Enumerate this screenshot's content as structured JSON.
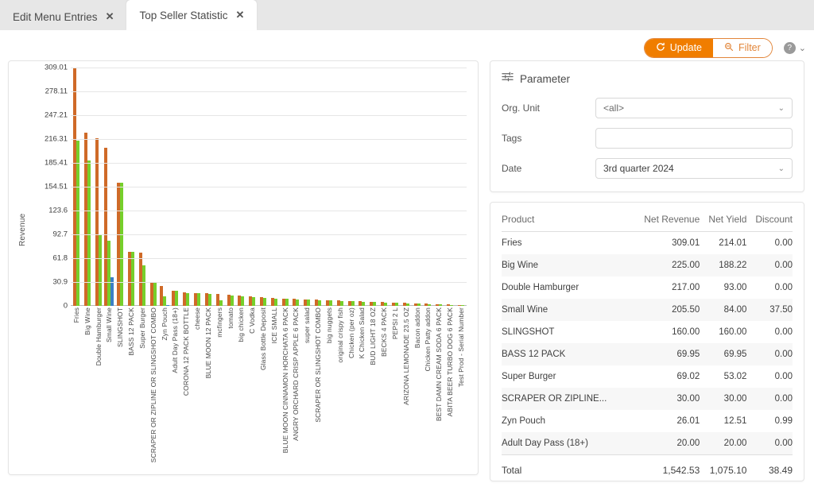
{
  "tabs": [
    {
      "label": "Edit Menu Entries",
      "close": "✕",
      "active": false
    },
    {
      "label": "Top Seller Statistic",
      "close": "✕",
      "active": true
    }
  ],
  "toolbar": {
    "update_label": "Update",
    "filter_label": "Filter",
    "help_label": "?",
    "chevron": "⌄",
    "update_color": "#f07d00",
    "filter_color": "#e2863a"
  },
  "parameter": {
    "title": "Parameter",
    "org_unit_label": "Org. Unit",
    "org_unit_value": "<all>",
    "tags_label": "Tags",
    "tags_value": "",
    "date_label": "Date",
    "date_value": "3rd quarter 2024",
    "caret": "⌄"
  },
  "table": {
    "columns": [
      "Product",
      "Net Revenue",
      "Net Yield",
      "Discount"
    ],
    "rows": [
      {
        "product": "Fries",
        "net_revenue": "309.01",
        "net_yield": "214.01",
        "discount": "0.00"
      },
      {
        "product": "Big Wine",
        "net_revenue": "225.00",
        "net_yield": "188.22",
        "discount": "0.00"
      },
      {
        "product": "Double Hamburger",
        "net_revenue": "217.00",
        "net_yield": "93.00",
        "discount": "0.00"
      },
      {
        "product": "Small Wine",
        "net_revenue": "205.50",
        "net_yield": "84.00",
        "discount": "37.50"
      },
      {
        "product": "SLINGSHOT",
        "net_revenue": "160.00",
        "net_yield": "160.00",
        "discount": "0.00"
      },
      {
        "product": "BASS 12 PACK",
        "net_revenue": "69.95",
        "net_yield": "69.95",
        "discount": "0.00"
      },
      {
        "product": "Super Burger",
        "net_revenue": "69.02",
        "net_yield": "53.02",
        "discount": "0.00"
      },
      {
        "product": "SCRAPER OR ZIPLINE...",
        "net_revenue": "30.00",
        "net_yield": "30.00",
        "discount": "0.00"
      },
      {
        "product": "Zyn Pouch",
        "net_revenue": "26.01",
        "net_yield": "12.51",
        "discount": "0.99"
      },
      {
        "product": "Adult Day Pass (18+)",
        "net_revenue": "20.00",
        "net_yield": "20.00",
        "discount": "0.00"
      }
    ],
    "total": {
      "product": "Total",
      "net_revenue": "1,542.53",
      "net_yield": "1,075.10",
      "discount": "38.49"
    }
  },
  "chart_data": {
    "type": "bar",
    "title": "",
    "xlabel": "",
    "ylabel": "Revenue",
    "ylim": [
      0,
      309.01
    ],
    "grid": true,
    "legend": "none",
    "yticks": [
      "0",
      "30.9",
      "61.8",
      "92.7",
      "123.6",
      "154.51",
      "185.41",
      "216.31",
      "247.21",
      "278.11",
      "309.01"
    ],
    "ytick_values": [
      0,
      30.9,
      61.8,
      92.7,
      123.6,
      154.51,
      185.41,
      216.31,
      247.21,
      278.11,
      309.01
    ],
    "colors": {
      "net_revenue": "#cf6a28",
      "net_yield": "#76cf2b",
      "discount": "#3a7fc4"
    },
    "categories": [
      "Fries",
      "Big Wine",
      "Double Hamburger",
      "Small Wine",
      "SLINGSHOT",
      "BASS 12 PACK",
      "Super Burger",
      "SCRAPER OR ZIPLINE OR SLINGSHOT COMBO",
      "Zyn Pouch",
      "Adult Day Pass (18+)",
      "CORONA 12 PACK BOTTLE",
      "cheese",
      "BLUE MOON 12 PACK",
      "mcfingers",
      "tomato",
      "big chicken",
      "C Vodka",
      "Glass Bottle Deposit",
      "ICE SMALL",
      "BLUE MOON CINNAMON HORCHATA 6 PACK",
      "ANGRY ORCHARD CRISP APPLE 6 PACK",
      "super salad",
      "SCRAPER OR SLINGSHOT COMBO",
      "big nuggets",
      "original crispy fish",
      "Chicken (per oz)",
      "K Chicken Salad",
      "BUD LIGHT 18 OZ",
      "BECKS 4 PACK",
      "PEPSI 2 L",
      "ARIZONA LEMONADE 23.5 OZ",
      "Bacon addon",
      "Chicken Patty addon",
      "BEST DAMN CREAM SODA 6 PACK",
      "ABITA BEER TURBO DOG 6 PACK",
      "Test Prod - Serial Number"
    ],
    "series": [
      {
        "name": "Net Revenue",
        "color": "#cf6a28",
        "values": [
          309.01,
          225.0,
          217.0,
          205.5,
          160.0,
          69.95,
          69.02,
          30.0,
          26.01,
          20.0,
          18.0,
          17.0,
          16.0,
          15.0,
          14.0,
          13.0,
          12.0,
          11.0,
          10.0,
          9.5,
          9.0,
          8.5,
          8.0,
          7.5,
          7.0,
          6.5,
          6.0,
          5.5,
          5.0,
          4.5,
          4.0,
          3.5,
          3.0,
          2.5,
          2.0,
          1.5
        ]
      },
      {
        "name": "Net Yield",
        "color": "#76cf2b",
        "values": [
          214.01,
          188.22,
          93.0,
          84.0,
          160.0,
          69.95,
          53.02,
          30.0,
          12.51,
          20.0,
          17.0,
          16.0,
          15.5,
          7.0,
          13.0,
          12.0,
          11.5,
          10.5,
          9.5,
          9.0,
          8.5,
          8.0,
          7.5,
          7.0,
          6.5,
          6.0,
          5.5,
          5.0,
          4.5,
          4.0,
          3.5,
          3.0,
          2.5,
          2.0,
          1.5,
          1.0
        ]
      },
      {
        "name": "Discount",
        "color": "#3a7fc4",
        "values": [
          0,
          0,
          0,
          37.5,
          0,
          0,
          0,
          0,
          0.99,
          0,
          0,
          0,
          0,
          0,
          0,
          0,
          0,
          0,
          0,
          0,
          0,
          0,
          0,
          0,
          0,
          0,
          0,
          0,
          0,
          0,
          0,
          0,
          0,
          0,
          0,
          0
        ]
      }
    ]
  }
}
